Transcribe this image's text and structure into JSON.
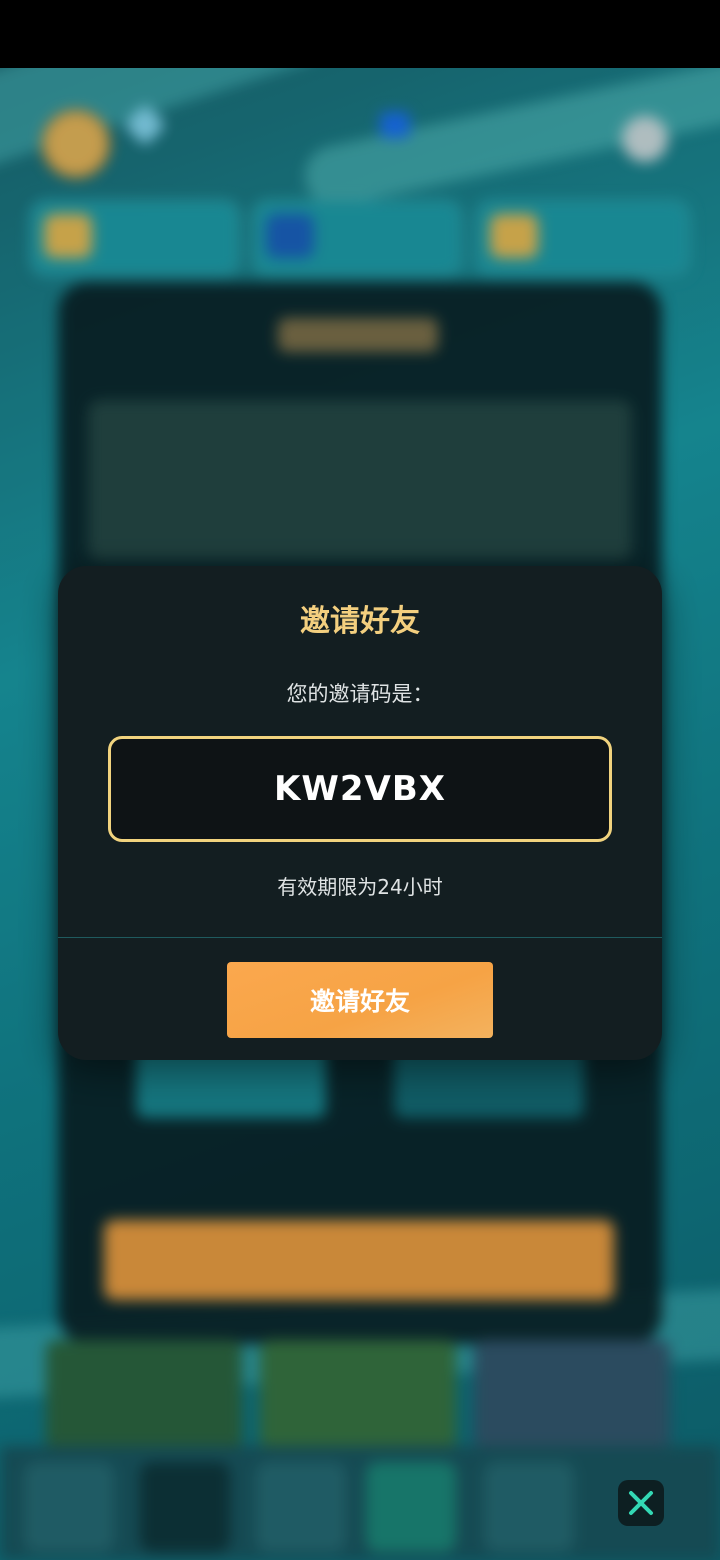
{
  "dialog": {
    "title": "邀请好友",
    "code_label": "您的邀请码是：",
    "code_value": "KW2VBX",
    "validity_text": "有效期限为24小时",
    "invite_button_label": "邀请好友"
  },
  "icons": {
    "close": "close-icon"
  },
  "colors": {
    "accent_gold": "#f3cf7f",
    "button_orange": "#f6a345",
    "dialog_bg": "#131e21",
    "close_x": "#33d8b4"
  }
}
